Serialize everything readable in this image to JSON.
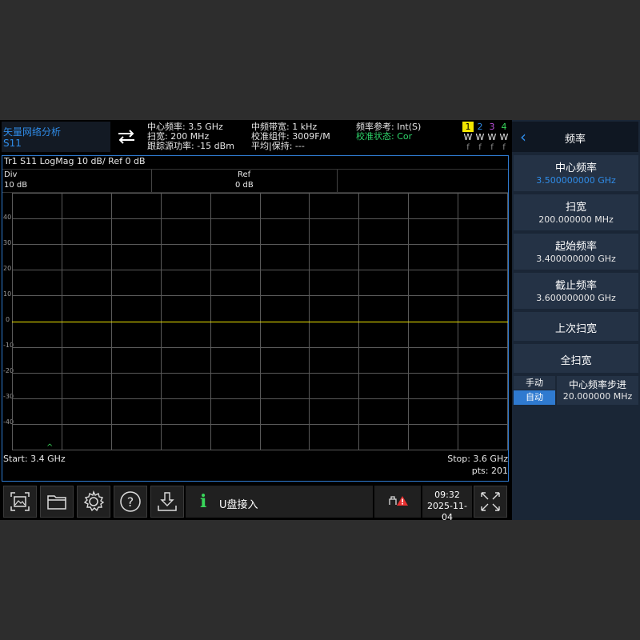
{
  "header": {
    "app_title": "矢量网络分析",
    "measurement": "S11",
    "col1": [
      "中心频率: 3.5 GHz",
      "扫宽: 200 MHz",
      "跟踪源功率: -15 dBm"
    ],
    "col2": [
      "中频带宽: 1 kHz",
      "校准组件: 3009F/M",
      "平均|保持: ---"
    ],
    "col3_line1": "频率参考: Int(S)",
    "col3_line2": "校准状态: Cor",
    "traces": [
      {
        "num": "1",
        "w": "W",
        "f": "f",
        "color": "#f2e600"
      },
      {
        "num": "2",
        "w": "W",
        "f": "f",
        "color": "#2f8ce8"
      },
      {
        "num": "3",
        "w": "W",
        "f": "f",
        "color": "#c050e0"
      },
      {
        "num": "4",
        "w": "W",
        "f": "f",
        "color": "#38d65a"
      }
    ]
  },
  "graph": {
    "trace_title": "Tr1 S11 LogMag 10 dB/ Ref 0 dB",
    "div_label": "Div",
    "div_value": "10 dB",
    "ref_label": "Ref",
    "ref_value": "0 dB",
    "y_ticks": [
      "40",
      "30",
      "20",
      "10",
      "0",
      "-10",
      "-20",
      "-30",
      "-40"
    ],
    "start": "Start: 3.4 GHz",
    "stop": "Stop: 3.6 GHz",
    "pts": "pts: 201",
    "marker_symbol": "^",
    "trace_color": "#f2e600",
    "grid_color": "#5a5a5a"
  },
  "toolbar": {
    "icons": [
      "screenshot-icon",
      "folder-icon",
      "gear-icon",
      "help-icon",
      "download-icon"
    ],
    "message_icon": "i",
    "message": "U盘接入",
    "time": "09:32",
    "date": "2025-11-04"
  },
  "panel": {
    "title": "频率",
    "back_icon": "‹",
    "items": [
      {
        "label": "中心频率",
        "value": "3.500000000 GHz"
      },
      {
        "label": "扫宽",
        "value": "200.000000 MHz"
      },
      {
        "label": "起始频率",
        "value": "3.400000000 GHz"
      },
      {
        "label": "截止频率",
        "value": "3.600000000 GHz"
      },
      {
        "label": "上次扫宽",
        "value": ""
      },
      {
        "label": "全扫宽",
        "value": ""
      }
    ],
    "toggle_manual": "手动",
    "toggle_auto": "自动",
    "step_label": "中心频率步进",
    "step_value": "20.000000 MHz"
  }
}
